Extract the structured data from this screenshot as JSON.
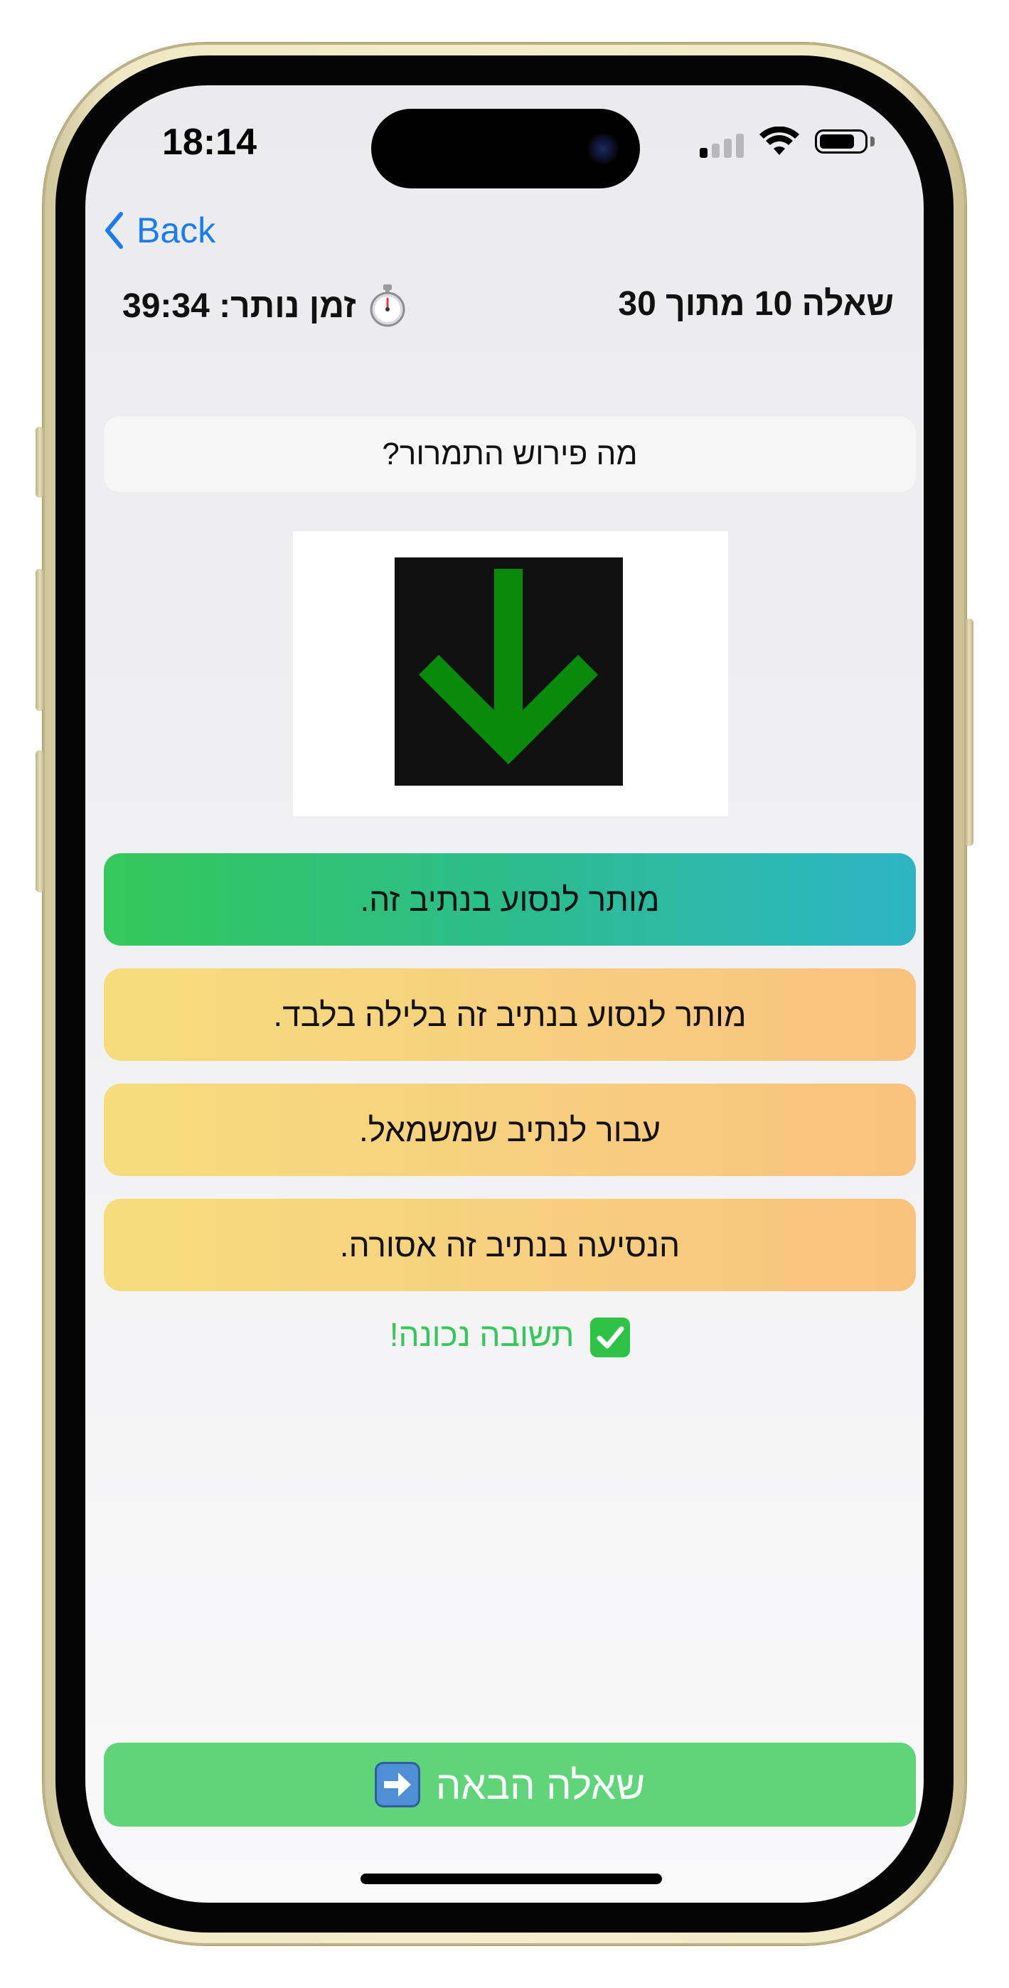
{
  "status_bar": {
    "time": "18:14"
  },
  "nav": {
    "back_label": "Back"
  },
  "quiz": {
    "question_counter": "שאלה 10 מתוך 30",
    "timer_text": "זמן נותר: 39:34",
    "timer_icon": "stopwatch-icon",
    "question_text": "מה פירוש התמרור?",
    "answers": [
      {
        "label": "מותר לנסוע בנתיב זה.",
        "state": "correct"
      },
      {
        "label": "מותר לנסוע בנתיב זה בלילה בלבד.",
        "state": "default"
      },
      {
        "label": "עבור לנתיב שמשמאל.",
        "state": "default"
      },
      {
        "label": "הנסיעה בנתיב זה אסורה.",
        "state": "default"
      }
    ],
    "feedback_text": "תשובה נכונה!",
    "feedback_icon": "check-mark-icon",
    "next_button_label": "שאלה הבאה",
    "next_button_icon": "right-arrow-icon"
  },
  "colors": {
    "accent_blue": "#1a7cf5",
    "correct_green": "#34c759",
    "next_button": "#5fd479",
    "sign_arrow": "#0a8a0a"
  }
}
